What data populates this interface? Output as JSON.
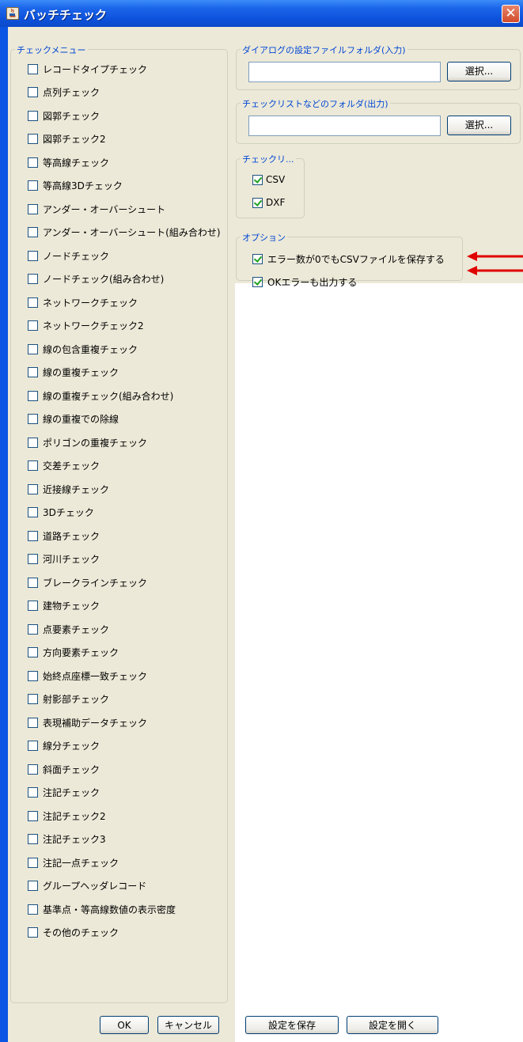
{
  "window": {
    "title": "バッチチェック"
  },
  "check_menu": {
    "legend": "チェックメニュー",
    "items": [
      "レコードタイプチェック",
      "点列チェック",
      "図郭チェック",
      "図郭チェック2",
      "等高線チェック",
      "等高線3Dチェック",
      "アンダー・オーバーシュート",
      "アンダー・オーバーシュート(組み合わせ)",
      "ノードチェック",
      "ノードチェック(組み合わせ)",
      "ネットワークチェック",
      "ネットワークチェック2",
      "線の包含重複チェック",
      "線の重複チェック",
      "線の重複チェック(組み合わせ)",
      "線の重複での除線",
      "ポリゴンの重複チェック",
      "交差チェック",
      "近接線チェック",
      "3Dチェック",
      "道路チェック",
      "河川チェック",
      "ブレークラインチェック",
      "建物チェック",
      "点要素チェック",
      "方向要素チェック",
      "始終点座標一致チェック",
      "射影部チェック",
      "表現補助データチェック",
      "線分チェック",
      "斜面チェック",
      "注記チェック",
      "注記チェック2",
      "注記チェック3",
      "注記一点チェック",
      "グループヘッダレコード",
      "基準点・等高線数値の表示密度",
      "その他のチェック"
    ]
  },
  "input_folder": {
    "legend": "ダイアログの設定ファイルフォルダ(入力)",
    "value": "",
    "select_label": "選択..."
  },
  "output_folder": {
    "legend": "チェックリストなどのフォルダ(出力)",
    "value": "",
    "select_label": "選択..."
  },
  "checklist": {
    "legend": "チェックリ...",
    "items": [
      {
        "label": "CSV",
        "checked": true
      },
      {
        "label": "DXF",
        "checked": true
      }
    ]
  },
  "options": {
    "legend": "オプション",
    "items": [
      {
        "label": "エラー数が0でもCSVファイルを保存する",
        "checked": true
      },
      {
        "label": "OKエラーも出力する",
        "checked": true
      }
    ]
  },
  "buttons": {
    "ok": "OK",
    "cancel": "キャンセル",
    "save": "設定を保存",
    "open": "設定を開く"
  },
  "colors": {
    "title_bar": "#0a55e3",
    "dialog_bg": "#ece9d8",
    "legend_text": "#0046d5",
    "annotation_arrow": "#e00000"
  }
}
